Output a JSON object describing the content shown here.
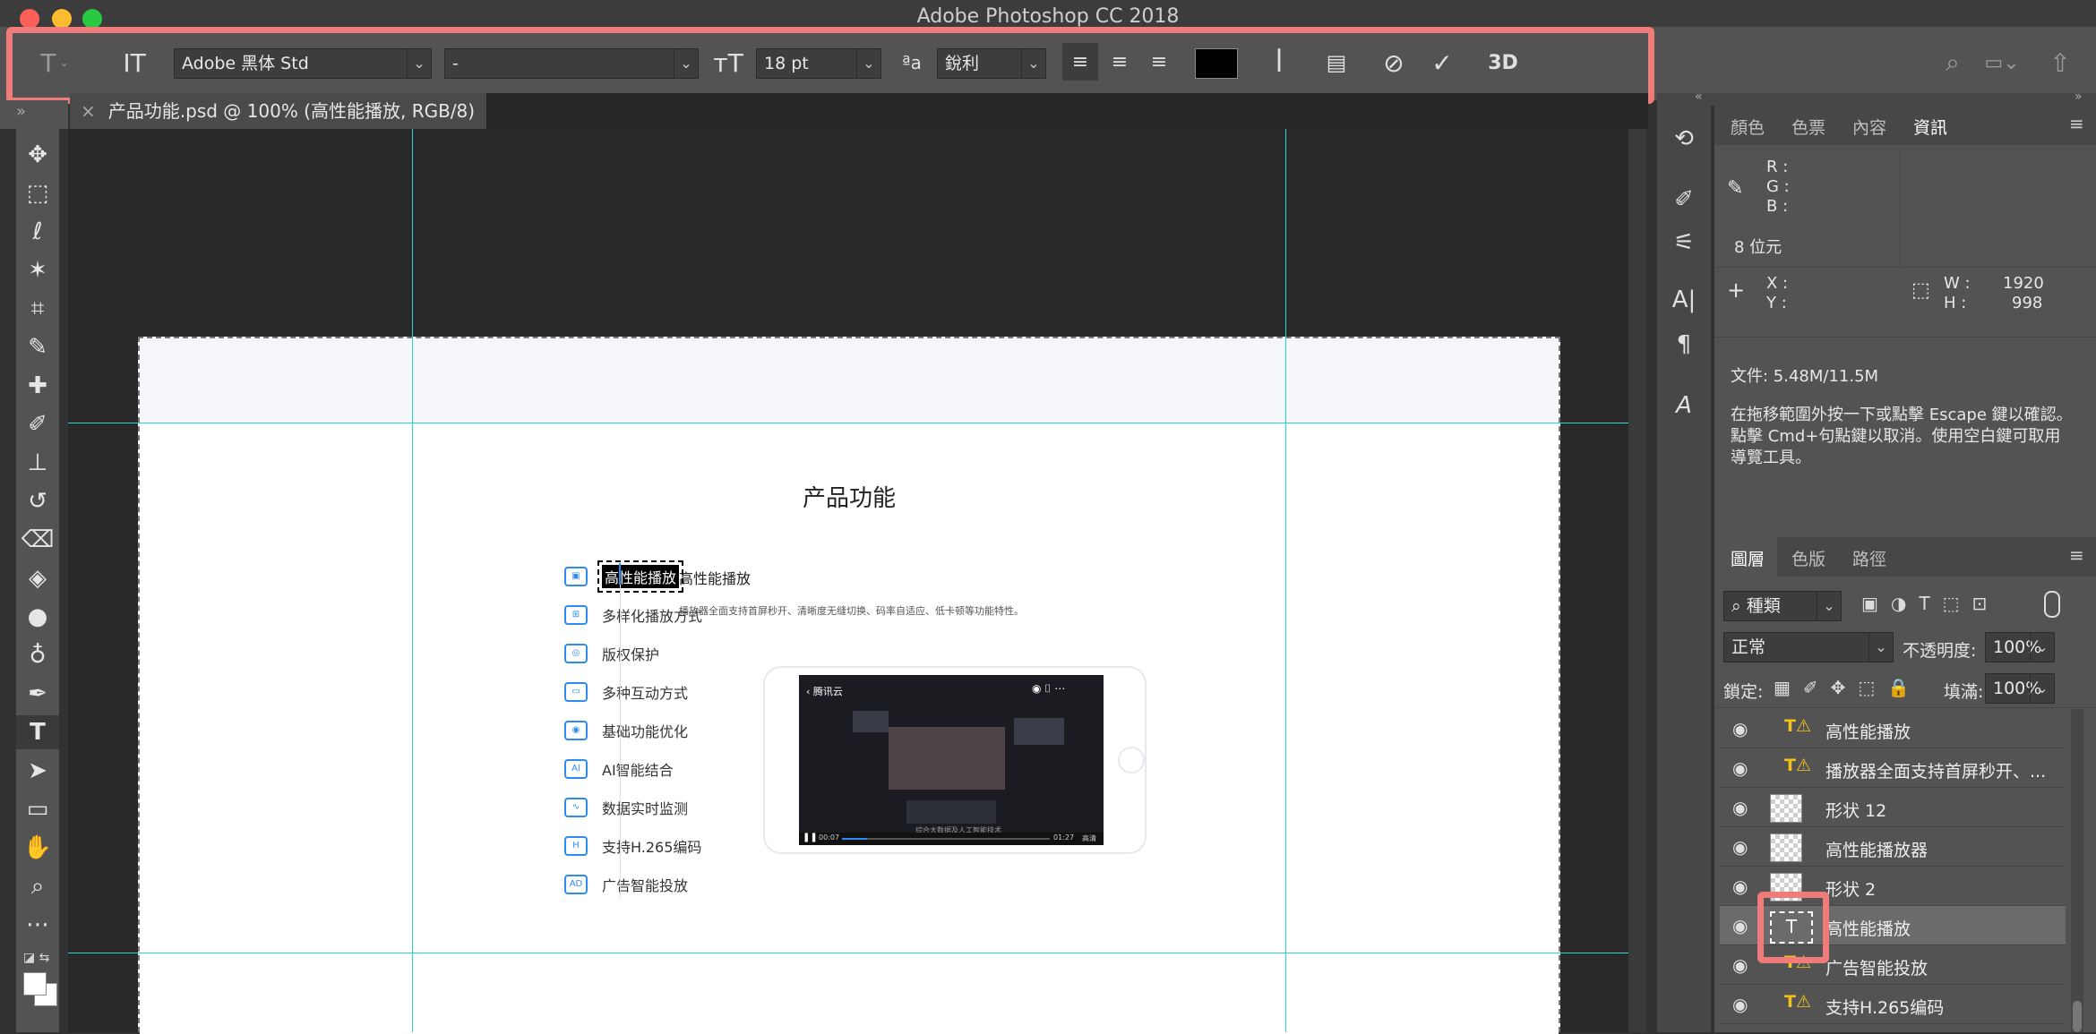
{
  "window": {
    "title": "Adobe Photoshop CC 2018"
  },
  "options_bar": {
    "tool_icon": "type-tool-icon",
    "font_family": "Adobe 黑体 Std",
    "font_style": "-",
    "font_size": "18 pt",
    "aa_label": "ªa",
    "anti_alias": "銳利",
    "three_d_label": "3D"
  },
  "document_tab": {
    "close": "×",
    "name": "产品功能.psd @ 100% (高性能播放, RGB/8) *"
  },
  "collapse": {
    "left": "»",
    "mid": "«",
    "right": "»"
  },
  "artboard": {
    "heading": "产品功能",
    "menu": [
      "高性能播放",
      "多样化播放方式",
      "版权保护",
      "多种互动方式",
      "基础功能优化",
      "AI智能结合",
      "数据实时监测",
      "支持H.265编码",
      "广告智能投放"
    ],
    "menu_icons": [
      "▣",
      "⊞",
      "◎",
      "▭",
      "◉",
      "AI",
      "∿",
      "H",
      "AD"
    ],
    "detail_title": "高性能播放",
    "detail_desc": "播放器全面支持首屏秒开、清晰度无缝切换、码率自适应、低卡顿等功能特性。",
    "player": {
      "back": "‹ 腾讯云",
      "time_start": "00:07",
      "time_end": "01:27",
      "quality": "高清",
      "caption": "综合大数据及人工智能技术"
    }
  },
  "info_panel": {
    "tabs": [
      "顏色",
      "色票",
      "內容",
      "資訊"
    ],
    "rgb_labels": [
      "R :",
      "G :",
      "B :"
    ],
    "bit_depth": "8 位元",
    "xy_labels": [
      "X :",
      "Y :"
    ],
    "w_label": "W :",
    "w_value": "1920",
    "h_label": "H :",
    "h_value": "998",
    "file_size": "文件: 5.48M/11.5M",
    "hint": "在拖移範圍外按一下或點擊 Escape 鍵以確認。點擊 Cmd+句點鍵以取消。使用空白鍵可取用導覽工具。"
  },
  "layers_panel": {
    "tabs": [
      "圖層",
      "色版",
      "路徑"
    ],
    "filter_kind": "種類",
    "blend_mode": "正常",
    "opacity_label": "不透明度:",
    "opacity": "100%",
    "lock_label": "鎖定:",
    "fill_label": "填滿:",
    "fill": "100%",
    "layers": [
      {
        "name": "高性能播放",
        "kind": "text-warn"
      },
      {
        "name": "播放器全面支持首屏秒开、...",
        "kind": "text-warn"
      },
      {
        "name": "形状 12",
        "kind": "shape"
      },
      {
        "name": "高性能播放器",
        "kind": "shape"
      },
      {
        "name": "形状 2",
        "kind": "shape"
      },
      {
        "name": "高性能播放",
        "kind": "text-selected"
      },
      {
        "name": "广告智能投放",
        "kind": "text-warn"
      },
      {
        "name": "支持H.265编码",
        "kind": "text-warn"
      }
    ]
  },
  "colors": {
    "highlight": "#f07b7b",
    "guide": "#26d5d5",
    "accent_blue": "#2d8cf0"
  }
}
